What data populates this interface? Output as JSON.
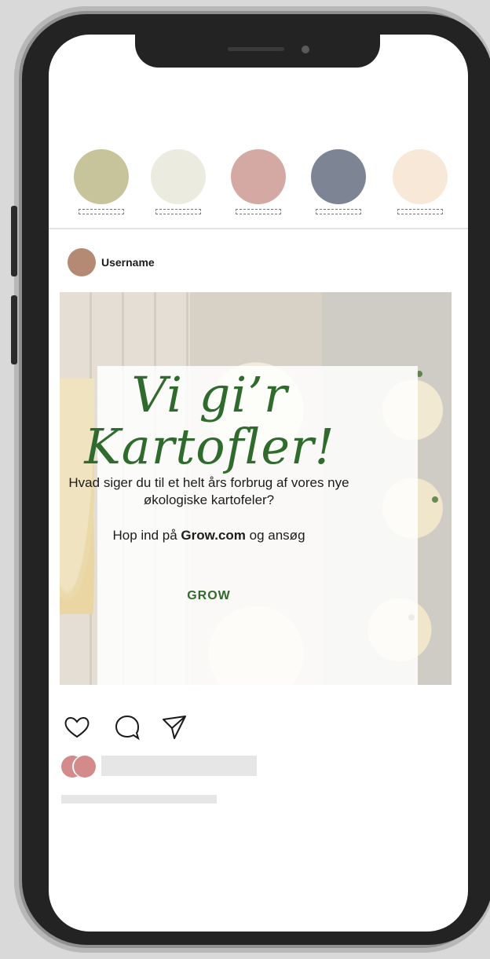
{
  "stories": [
    {
      "color": "#c7c39b"
    },
    {
      "color": "#ecebe0"
    },
    {
      "color": "#d4a9a4"
    },
    {
      "color": "#7d8594"
    },
    {
      "color": "#f8e8d8"
    }
  ],
  "post": {
    "username": "Username",
    "headline_line1": "Vi gi’r",
    "headline_line2": "Kartofler!",
    "body": "Hvad siger du til et helt års forbrug af vores nye økologiske kartofeler?",
    "cta_prefix": "Hop ind på ",
    "cta_link": "Grow.com",
    "cta_suffix": " og ansøg",
    "brand": "GROW"
  },
  "actions": {
    "like_icon": "heart-icon",
    "comment_icon": "comment-icon",
    "share_icon": "send-icon"
  }
}
